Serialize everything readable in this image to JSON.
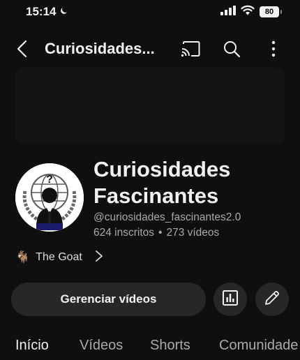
{
  "status_bar": {
    "time": "15:14",
    "battery": "80",
    "icons": [
      "moon-icon",
      "signal-icon",
      "wifi-icon",
      "battery-icon"
    ]
  },
  "topbar": {
    "title": "Curiosidades...",
    "icons": [
      "back-icon",
      "cast-icon",
      "search-icon",
      "more-vert-icon"
    ]
  },
  "channel": {
    "name": "Curiosidades Fascinantes",
    "handle": "@curiosidades_fascinantes2.0",
    "subscribers": "624 inscritos",
    "separator": "•",
    "videos": "273 vídeos",
    "link_icon": "🐐",
    "link_text": "The Goat"
  },
  "actions": {
    "manage_label": "Gerenciar vídeos",
    "icons": [
      "analytics-icon",
      "edit-pencil-icon"
    ]
  },
  "tabs": [
    {
      "label": "Início",
      "active": true
    },
    {
      "label": "Vídeos",
      "active": false
    },
    {
      "label": "Shorts",
      "active": false
    },
    {
      "label": "Comunidade",
      "active": false
    }
  ],
  "colors": {
    "background": "#0f0f0f",
    "text_primary": "#f1f1f1",
    "text_secondary": "#aaaaaa",
    "button_bg": "#272727"
  }
}
